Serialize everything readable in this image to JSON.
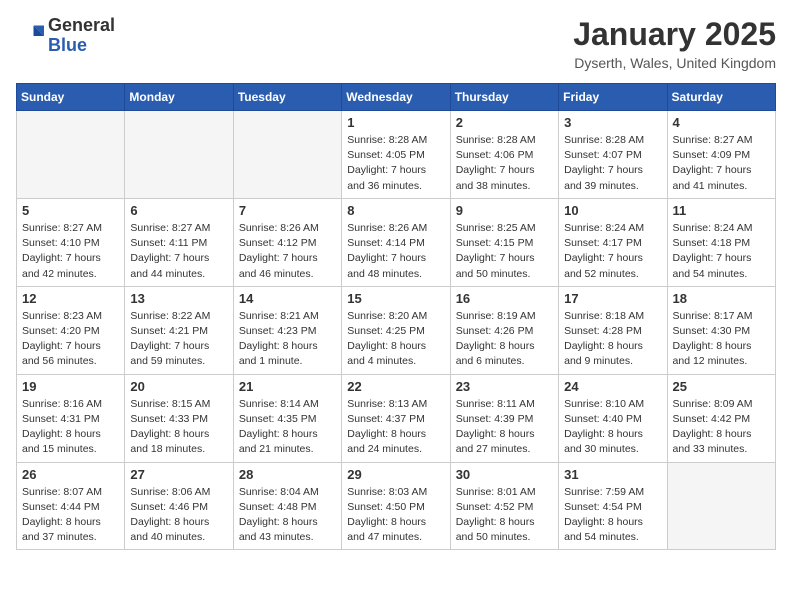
{
  "logo": {
    "general": "General",
    "blue": "Blue"
  },
  "title": "January 2025",
  "location": "Dyserth, Wales, United Kingdom",
  "days_of_week": [
    "Sunday",
    "Monday",
    "Tuesday",
    "Wednesday",
    "Thursday",
    "Friday",
    "Saturday"
  ],
  "weeks": [
    [
      {
        "day": "",
        "info": ""
      },
      {
        "day": "",
        "info": ""
      },
      {
        "day": "",
        "info": ""
      },
      {
        "day": "1",
        "info": "Sunrise: 8:28 AM\nSunset: 4:05 PM\nDaylight: 7 hours and 36 minutes."
      },
      {
        "day": "2",
        "info": "Sunrise: 8:28 AM\nSunset: 4:06 PM\nDaylight: 7 hours and 38 minutes."
      },
      {
        "day": "3",
        "info": "Sunrise: 8:28 AM\nSunset: 4:07 PM\nDaylight: 7 hours and 39 minutes."
      },
      {
        "day": "4",
        "info": "Sunrise: 8:27 AM\nSunset: 4:09 PM\nDaylight: 7 hours and 41 minutes."
      }
    ],
    [
      {
        "day": "5",
        "info": "Sunrise: 8:27 AM\nSunset: 4:10 PM\nDaylight: 7 hours and 42 minutes."
      },
      {
        "day": "6",
        "info": "Sunrise: 8:27 AM\nSunset: 4:11 PM\nDaylight: 7 hours and 44 minutes."
      },
      {
        "day": "7",
        "info": "Sunrise: 8:26 AM\nSunset: 4:12 PM\nDaylight: 7 hours and 46 minutes."
      },
      {
        "day": "8",
        "info": "Sunrise: 8:26 AM\nSunset: 4:14 PM\nDaylight: 7 hours and 48 minutes."
      },
      {
        "day": "9",
        "info": "Sunrise: 8:25 AM\nSunset: 4:15 PM\nDaylight: 7 hours and 50 minutes."
      },
      {
        "day": "10",
        "info": "Sunrise: 8:24 AM\nSunset: 4:17 PM\nDaylight: 7 hours and 52 minutes."
      },
      {
        "day": "11",
        "info": "Sunrise: 8:24 AM\nSunset: 4:18 PM\nDaylight: 7 hours and 54 minutes."
      }
    ],
    [
      {
        "day": "12",
        "info": "Sunrise: 8:23 AM\nSunset: 4:20 PM\nDaylight: 7 hours and 56 minutes."
      },
      {
        "day": "13",
        "info": "Sunrise: 8:22 AM\nSunset: 4:21 PM\nDaylight: 7 hours and 59 minutes."
      },
      {
        "day": "14",
        "info": "Sunrise: 8:21 AM\nSunset: 4:23 PM\nDaylight: 8 hours and 1 minute."
      },
      {
        "day": "15",
        "info": "Sunrise: 8:20 AM\nSunset: 4:25 PM\nDaylight: 8 hours and 4 minutes."
      },
      {
        "day": "16",
        "info": "Sunrise: 8:19 AM\nSunset: 4:26 PM\nDaylight: 8 hours and 6 minutes."
      },
      {
        "day": "17",
        "info": "Sunrise: 8:18 AM\nSunset: 4:28 PM\nDaylight: 8 hours and 9 minutes."
      },
      {
        "day": "18",
        "info": "Sunrise: 8:17 AM\nSunset: 4:30 PM\nDaylight: 8 hours and 12 minutes."
      }
    ],
    [
      {
        "day": "19",
        "info": "Sunrise: 8:16 AM\nSunset: 4:31 PM\nDaylight: 8 hours and 15 minutes."
      },
      {
        "day": "20",
        "info": "Sunrise: 8:15 AM\nSunset: 4:33 PM\nDaylight: 8 hours and 18 minutes."
      },
      {
        "day": "21",
        "info": "Sunrise: 8:14 AM\nSunset: 4:35 PM\nDaylight: 8 hours and 21 minutes."
      },
      {
        "day": "22",
        "info": "Sunrise: 8:13 AM\nSunset: 4:37 PM\nDaylight: 8 hours and 24 minutes."
      },
      {
        "day": "23",
        "info": "Sunrise: 8:11 AM\nSunset: 4:39 PM\nDaylight: 8 hours and 27 minutes."
      },
      {
        "day": "24",
        "info": "Sunrise: 8:10 AM\nSunset: 4:40 PM\nDaylight: 8 hours and 30 minutes."
      },
      {
        "day": "25",
        "info": "Sunrise: 8:09 AM\nSunset: 4:42 PM\nDaylight: 8 hours and 33 minutes."
      }
    ],
    [
      {
        "day": "26",
        "info": "Sunrise: 8:07 AM\nSunset: 4:44 PM\nDaylight: 8 hours and 37 minutes."
      },
      {
        "day": "27",
        "info": "Sunrise: 8:06 AM\nSunset: 4:46 PM\nDaylight: 8 hours and 40 minutes."
      },
      {
        "day": "28",
        "info": "Sunrise: 8:04 AM\nSunset: 4:48 PM\nDaylight: 8 hours and 43 minutes."
      },
      {
        "day": "29",
        "info": "Sunrise: 8:03 AM\nSunset: 4:50 PM\nDaylight: 8 hours and 47 minutes."
      },
      {
        "day": "30",
        "info": "Sunrise: 8:01 AM\nSunset: 4:52 PM\nDaylight: 8 hours and 50 minutes."
      },
      {
        "day": "31",
        "info": "Sunrise: 7:59 AM\nSunset: 4:54 PM\nDaylight: 8 hours and 54 minutes."
      },
      {
        "day": "",
        "info": ""
      }
    ]
  ]
}
